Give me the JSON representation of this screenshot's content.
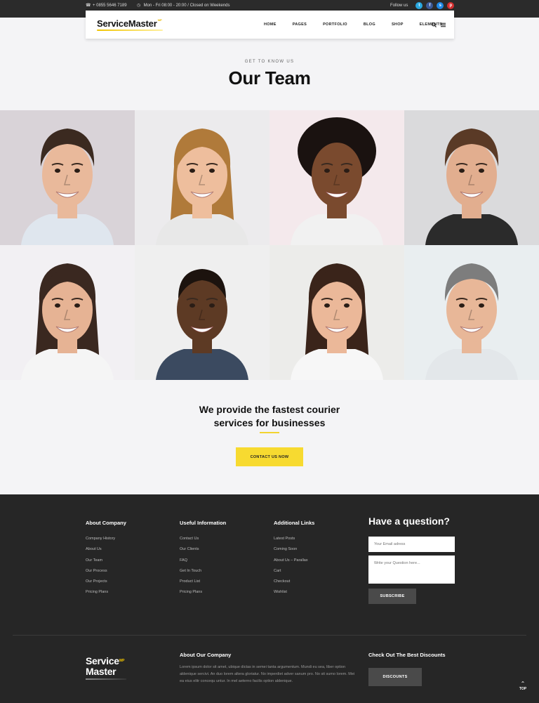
{
  "topbar": {
    "phone": "+ 0855 5646 7189",
    "hours": "Mon - Fri 08:00 - 20:00 / Closed on Weekends",
    "follow_label": "Follow us",
    "socials": [
      {
        "icon": "twitter-icon",
        "glyph": "t",
        "color": "#29a8e0"
      },
      {
        "icon": "facebook-icon",
        "glyph": "f",
        "color": "#3b5998"
      },
      {
        "icon": "skype-icon",
        "glyph": "s",
        "color": "#1e88e5"
      },
      {
        "icon": "pinterest-icon",
        "glyph": "p",
        "color": "#d32f2f"
      }
    ]
  },
  "header": {
    "logo": "ServiceMaster",
    "logo_sup": "WP",
    "nav": [
      "HOME",
      "PAGES",
      "PORTFOLIO",
      "BLOG",
      "SHOP",
      "ELEMENTS"
    ],
    "icons": [
      "search-icon",
      "menu-icon"
    ]
  },
  "intro": {
    "eyebrow": "GET TO KNOW US",
    "title": "Our Team"
  },
  "team": [
    {
      "bg": "#d9d3d8",
      "skin": "#e9b99b",
      "hair": "#3b2a20",
      "shirt": "#dfe6ee",
      "hair_style": "short"
    },
    {
      "bg": "#ecebed",
      "skin": "#eebe9d",
      "hair": "#b07a3a",
      "shirt": "#e8e8e8",
      "hair_style": "long"
    },
    {
      "bg": "#f4e9ec",
      "skin": "#7a4a2e",
      "hair": "#1a1210",
      "shirt": "#f1f1f1",
      "hair_style": "afro"
    },
    {
      "bg": "#dadadc",
      "skin": "#e2ae8f",
      "hair": "#5a3a26",
      "shirt": "#2b2b2b",
      "hair_style": "short"
    },
    {
      "bg": "#f2f0f3",
      "skin": "#e6b394",
      "hair": "#3a2820",
      "shirt": "#f5f5f5",
      "hair_style": "long"
    },
    {
      "bg": "#efefef",
      "skin": "#5d3a24",
      "hair": "#1c130e",
      "shirt": "#3b4a60",
      "hair_style": "buzz"
    },
    {
      "bg": "#ececea",
      "skin": "#ebb899",
      "hair": "#3a241a",
      "shirt": "#f7f7f7",
      "hair_style": "long"
    },
    {
      "bg": "#e9eef0",
      "skin": "#e8b798",
      "hair": "#7d7d7d",
      "shirt": "#e3e7ea",
      "hair_style": "short"
    }
  ],
  "cta": {
    "line1": "We provide the fastest courier",
    "line2": "services for businesses",
    "button": "CONTACT US NOW",
    "accent": "#f7da30"
  },
  "footer": {
    "columns": [
      {
        "title": "About Company",
        "items": [
          "Company History",
          "About Us",
          "Our Team",
          "Our Process",
          "Our Projects",
          "Pricing Plans"
        ]
      },
      {
        "title": "Useful Information",
        "items": [
          "Contact Us",
          "Our Clients",
          "FAQ",
          "Get In Touch",
          "Product List",
          "Pricing Plans"
        ]
      },
      {
        "title": "Additional Links",
        "items": [
          "Latest Posts",
          "Coming Soon",
          "About Us – Parallax",
          "Cart",
          "Checkout",
          "Wishlist"
        ]
      }
    ],
    "question": {
      "title": "Have a question?",
      "email_placeholder": "Your Email adress",
      "question_placeholder": "Write your Question here...",
      "button": "SUBSCRIBE"
    },
    "logo_line1": "Service",
    "logo_sup": "WP",
    "logo_line2": "Master",
    "about_title": "About Our Company",
    "about_text": "Lorem ipsum dolor sit amet, ubique dictas in semei tanta argumentum. Mundi eu sea, liber option aldenique sercivi. An duo lorem altera gloriatur. No imperdiet adver sanum pro. No sit sumo lorem. Mei ea eius elitr concequ untur. In mel aeterno facilis option aldenique.",
    "discount_title": "Check Out The Best Discounts",
    "discount_button": "DISCOUNTS",
    "top_label": "TOP"
  }
}
